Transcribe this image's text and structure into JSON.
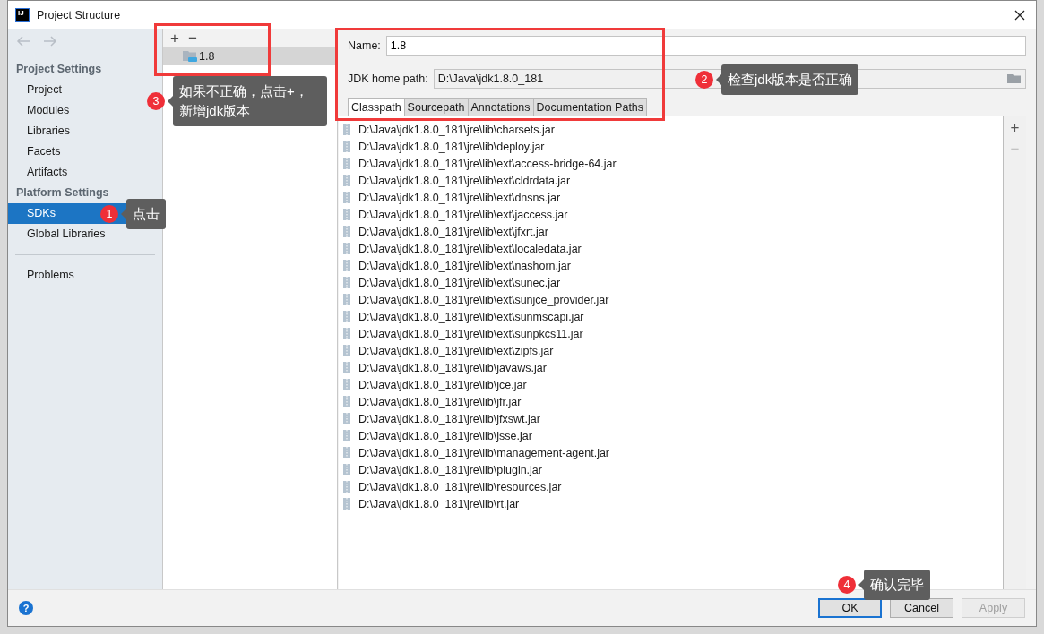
{
  "window": {
    "logo": "IJ",
    "title": "Project Structure"
  },
  "help": "?",
  "sidebar": {
    "sections": [
      {
        "heading": "Project Settings",
        "items": [
          {
            "label": "Project",
            "selected": false
          },
          {
            "label": "Modules",
            "selected": false
          },
          {
            "label": "Libraries",
            "selected": false
          },
          {
            "label": "Facets",
            "selected": false
          },
          {
            "label": "Artifacts",
            "selected": false
          }
        ]
      },
      {
        "heading": "Platform Settings",
        "items": [
          {
            "label": "SDKs",
            "selected": true
          },
          {
            "label": "Global Libraries",
            "selected": false
          }
        ]
      },
      {
        "items": [
          {
            "label": "Problems",
            "selected": false
          }
        ]
      }
    ]
  },
  "sdk_list": {
    "toolbar": [
      "+",
      "−"
    ],
    "items": [
      {
        "label": "1.8",
        "selected": true
      }
    ]
  },
  "sdk_details": {
    "name_label": "Name:",
    "name": "1.8",
    "home_label": "JDK home path:",
    "home_path": "D:\\Java\\jdk1.8.0_181",
    "tabs": [
      {
        "label": "Classpath",
        "selected": true
      },
      {
        "label": "Sourcepath",
        "selected": false
      },
      {
        "label": "Annotations",
        "selected": false
      },
      {
        "label": "Documentation Paths",
        "selected": false
      }
    ],
    "classpath": [
      "D:\\Java\\jdk1.8.0_181\\jre\\lib\\charsets.jar",
      "D:\\Java\\jdk1.8.0_181\\jre\\lib\\deploy.jar",
      "D:\\Java\\jdk1.8.0_181\\jre\\lib\\ext\\access-bridge-64.jar",
      "D:\\Java\\jdk1.8.0_181\\jre\\lib\\ext\\cldrdata.jar",
      "D:\\Java\\jdk1.8.0_181\\jre\\lib\\ext\\dnsns.jar",
      "D:\\Java\\jdk1.8.0_181\\jre\\lib\\ext\\jaccess.jar",
      "D:\\Java\\jdk1.8.0_181\\jre\\lib\\ext\\jfxrt.jar",
      "D:\\Java\\jdk1.8.0_181\\jre\\lib\\ext\\localedata.jar",
      "D:\\Java\\jdk1.8.0_181\\jre\\lib\\ext\\nashorn.jar",
      "D:\\Java\\jdk1.8.0_181\\jre\\lib\\ext\\sunec.jar",
      "D:\\Java\\jdk1.8.0_181\\jre\\lib\\ext\\sunjce_provider.jar",
      "D:\\Java\\jdk1.8.0_181\\jre\\lib\\ext\\sunmscapi.jar",
      "D:\\Java\\jdk1.8.0_181\\jre\\lib\\ext\\sunpkcs11.jar",
      "D:\\Java\\jdk1.8.0_181\\jre\\lib\\ext\\zipfs.jar",
      "D:\\Java\\jdk1.8.0_181\\jre\\lib\\javaws.jar",
      "D:\\Java\\jdk1.8.0_181\\jre\\lib\\jce.jar",
      "D:\\Java\\jdk1.8.0_181\\jre\\lib\\jfr.jar",
      "D:\\Java\\jdk1.8.0_181\\jre\\lib\\jfxswt.jar",
      "D:\\Java\\jdk1.8.0_181\\jre\\lib\\jsse.jar",
      "D:\\Java\\jdk1.8.0_181\\jre\\lib\\management-agent.jar",
      "D:\\Java\\jdk1.8.0_181\\jre\\lib\\plugin.jar",
      "D:\\Java\\jdk1.8.0_181\\jre\\lib\\resources.jar",
      "D:\\Java\\jdk1.8.0_181\\jre\\lib\\rt.jar"
    ],
    "side_toolbar": [
      {
        "label": "+",
        "disabled": false
      },
      {
        "label": "−",
        "disabled": true
      }
    ]
  },
  "buttons": [
    {
      "label": "OK",
      "default": true,
      "disabled": false
    },
    {
      "label": "Cancel",
      "default": false,
      "disabled": false
    },
    {
      "label": "Apply",
      "default": false,
      "disabled": true
    }
  ],
  "annotations": [
    {
      "number": "1",
      "text": "点击"
    },
    {
      "number": "2",
      "text": "检查jdk版本是否正确"
    },
    {
      "number": "3",
      "text": "如果不正确，点击+，新增jdk版本"
    },
    {
      "number": "4",
      "text": "确认完毕"
    }
  ]
}
